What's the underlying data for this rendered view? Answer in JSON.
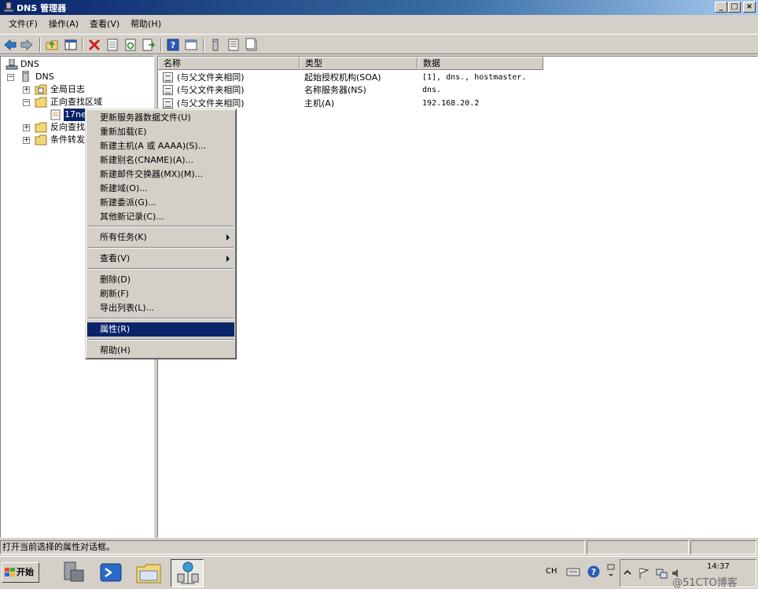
{
  "window": {
    "title": "DNS 管理器",
    "controls": [
      "_",
      "□",
      "×"
    ]
  },
  "menubar": {
    "items": [
      "文件(F)",
      "操作(A)",
      "查看(V)",
      "帮助(H)"
    ]
  },
  "toolbar": {
    "buttons": [
      "back-icon",
      "forward-icon",
      "up-icon",
      "show-hide-tree-icon",
      "delete-icon",
      "properties-icon",
      "refresh-icon",
      "export-icon",
      "help-icon",
      "mmc-icon",
      "server-icon",
      "list-icon",
      "doc-icon"
    ]
  },
  "tree": {
    "root": "DNS",
    "server": "DNS",
    "global_logs": "全局日志",
    "forward_zones": "正向查找区域",
    "zone": "17ne",
    "reverse_zones": "反向查找",
    "conditional_forwarders": "条件转发"
  },
  "list": {
    "columns": [
      "名称",
      "类型",
      "数据"
    ],
    "rows": [
      {
        "name": "(与父文件夹相同)",
        "type": "起始授权机构(SOA)",
        "data": "[1], dns., hostmaster."
      },
      {
        "name": "(与父文件夹相同)",
        "type": "名称服务器(NS)",
        "data": "dns."
      },
      {
        "name": "(与父文件夹相同)",
        "type": "主机(A)",
        "data": "192.168.20.2"
      }
    ]
  },
  "context_menu": {
    "items": [
      "更新服务器数据文件(U)",
      "重新加载(E)",
      "新建主机(A 或 AAAA)(S)...",
      "新建别名(CNAME)(A)...",
      "新建邮件交换器(MX)(M)...",
      "新建域(O)...",
      "新建委派(G)...",
      "其他新记录(C)...",
      "所有任务(K)",
      "查看(V)",
      "删除(D)",
      "刷新(F)",
      "导出列表(L)...",
      "属性(R)",
      "帮助(H)"
    ],
    "highlighted": "属性(R)"
  },
  "statusbar": {
    "text": "打开当前选择的属性对话框。"
  },
  "taskbar": {
    "start_label": "开始",
    "tray": {
      "lang": "CH",
      "time": "14:37"
    },
    "watermark": "@51CTO博客"
  },
  "colors": {
    "selection": "#0a246a",
    "face": "#d4d0c8"
  }
}
